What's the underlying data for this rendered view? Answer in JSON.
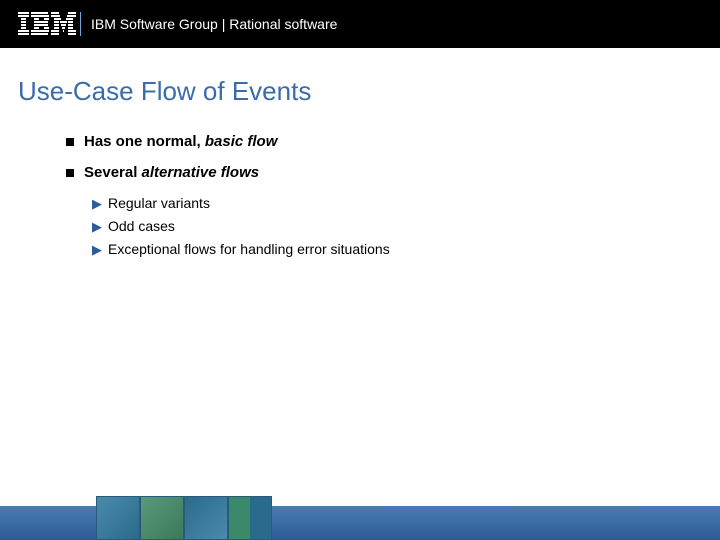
{
  "header": {
    "breadcrumb": "IBM Software Group | Rational software"
  },
  "slide": {
    "title": "Use-Case Flow of Events",
    "bullets": [
      {
        "lead": "Has one normal, ",
        "emph": "basic flow"
      },
      {
        "lead": "Several ",
        "emph": "alternative flows"
      }
    ],
    "subitems": [
      "Regular variants",
      "Odd cases",
      "Exceptional flows for handling error situations"
    ]
  }
}
